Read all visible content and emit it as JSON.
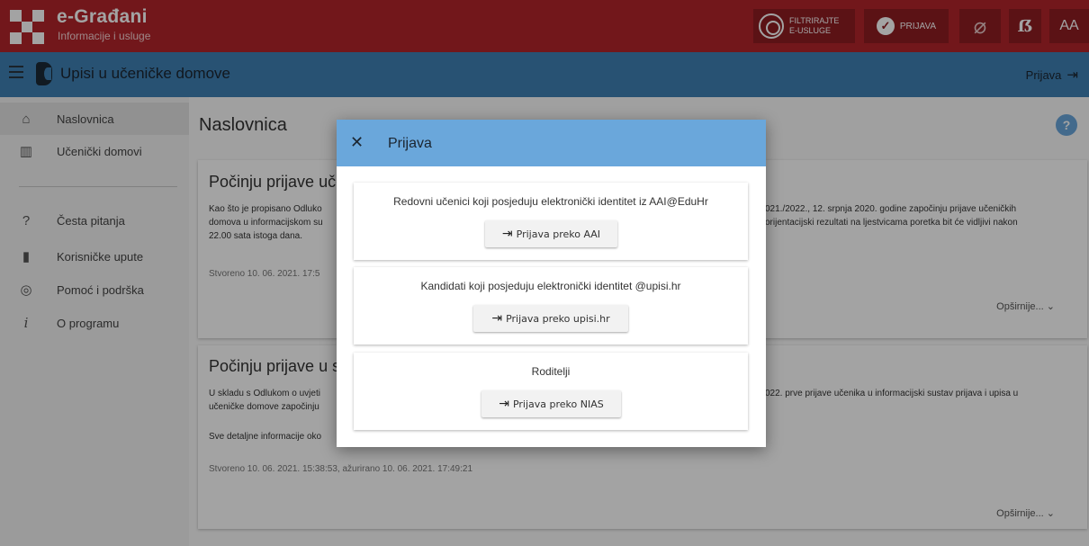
{
  "header": {
    "brand_title": "e-Građani",
    "brand_subtitle": "Informacije i usluge",
    "filter_label_line1": "FILTRIRAJTE",
    "filter_label_line2": "E-USLUGE",
    "login_label": "PRIJAVA",
    "eye_icon_glyph": "⌀",
    "font_icon_glyph": "ẞ",
    "text_size_label": "AA"
  },
  "navbar": {
    "app_title": "Upisi u učeničke domove",
    "login_label": "Prijava"
  },
  "sidebar": {
    "items": [
      {
        "label": "Naslovnica",
        "icon": "home-icon",
        "glyph": "⌂"
      },
      {
        "label": "Učenički domovi",
        "icon": "building-icon",
        "glyph": "▥"
      },
      {
        "label": "Česta pitanja",
        "icon": "question-icon",
        "glyph": "?"
      },
      {
        "label": "Korisničke upute",
        "icon": "book-icon",
        "glyph": "▮"
      },
      {
        "label": "Pomoć i podrška",
        "icon": "support-icon",
        "glyph": "◎"
      },
      {
        "label": "O programu",
        "icon": "info-icon",
        "glyph": "i"
      }
    ]
  },
  "main": {
    "page_title": "Naslovnica",
    "help_glyph": "?",
    "cards": [
      {
        "title_visible": "Počinju prijave učer",
        "text_left_line1": "Kao što je propisano Odluko",
        "text_left_line2": "domova u informacijskom su",
        "text_left_line3": "22.00 sata istoga dana.",
        "text_right_line1": "021./2022., 12. srpnja 2020. godine započinju prijave učeničkih",
        "text_right_line2": "orijentacijski rezultati na ljestvicama poretka bit će vidljivi nakon",
        "meta_visible": "Stvoreno 10. 06. 2021. 17:5",
        "more_label": "Opširnije... ⌄"
      },
      {
        "title_visible": "Počinju prijave u su",
        "text_left_line1": "U skladu s Odlukom o uvjeti",
        "text_left_line2": "učeničke domove započinju",
        "text_left_line3": "Sve detaljne informacije oko",
        "text_right_line1": "022. prve prijave učenika u informacijski sustav prijava i upisa u",
        "meta": "Stvoreno 10. 06. 2021. 15:38:53, ažurirano 10. 06. 2021. 17:49:21",
        "more_label": "Opširnije... ⌄"
      }
    ]
  },
  "modal": {
    "title": "Prijava",
    "close_glyph": "✕",
    "options": [
      {
        "description": "Redovni učenici koji posjeduju elektronički identitet iz AAI@EduHr",
        "button_label": "Prijava preko AAI"
      },
      {
        "description": "Kandidati koji posjeduju elektronički identitet @upisi.hr",
        "button_label": "Prijava preko upisi.hr"
      },
      {
        "description": "Roditelji",
        "button_label": "Prijava preko NIAS"
      }
    ]
  },
  "colors": {
    "header_red": "#b3252b",
    "header_button": "#8f1d22",
    "navbar_blue": "#3f80b4",
    "modal_head_blue": "#6aa7db"
  }
}
